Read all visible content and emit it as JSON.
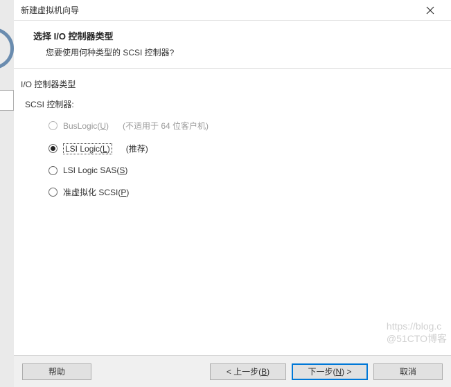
{
  "titlebar": {
    "title": "新建虚拟机向导"
  },
  "header": {
    "title": "选择 I/O 控制器类型",
    "subtitle": "您要使用何种类型的 SCSI 控制器?"
  },
  "section": {
    "title": "I/O 控制器类型",
    "scsi_label": "SCSI 控制器:"
  },
  "options": {
    "buslogic": {
      "label": "BusLogic(",
      "accel": "U",
      "tail": ")",
      "note": "(不适用于 64 位客户机)"
    },
    "lsi": {
      "label": "LSI Logic(",
      "accel": "L",
      "tail": ")",
      "note": "(推荐)"
    },
    "lsisas": {
      "label": "LSI Logic SAS(",
      "accel": "S",
      "tail": ")"
    },
    "paravirtual": {
      "label": "准虚拟化 SCSI(",
      "accel": "P",
      "tail": ")"
    }
  },
  "buttons": {
    "help": "帮助",
    "back": "< 上一步(",
    "back_accel": "B",
    "back_tail": ")",
    "next": "下一步(",
    "next_accel": "N",
    "next_tail": ") >",
    "cancel": "取消"
  },
  "watermark": {
    "line1": "https://blog.c",
    "line2": "@51CTO博客"
  }
}
